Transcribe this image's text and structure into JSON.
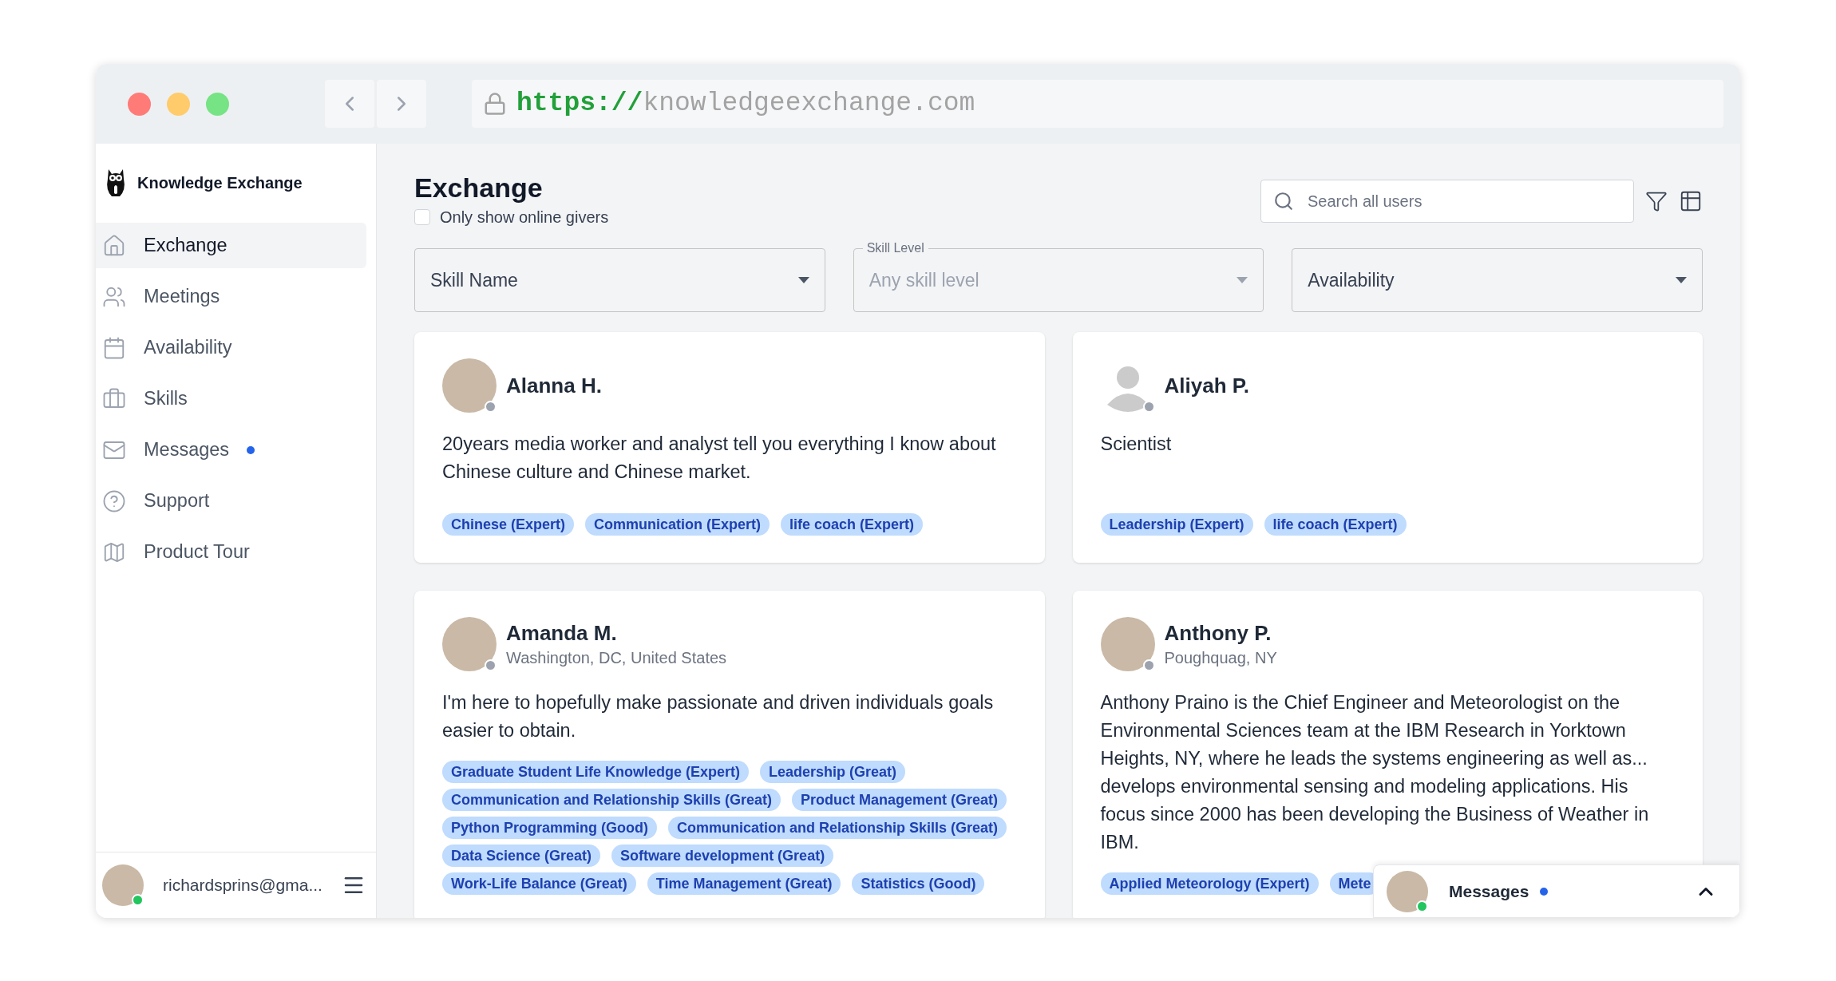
{
  "browser": {
    "url_scheme": "https://",
    "url_host": "knowledgeexchange.com"
  },
  "sidebar": {
    "brand": "Knowledge Exchange",
    "items": [
      {
        "label": "Exchange",
        "selected": true,
        "unread": false
      },
      {
        "label": "Meetings",
        "selected": false,
        "unread": false
      },
      {
        "label": "Availability",
        "selected": false,
        "unread": false
      },
      {
        "label": "Skills",
        "selected": false,
        "unread": false
      },
      {
        "label": "Messages",
        "selected": false,
        "unread": true
      },
      {
        "label": "Support",
        "selected": false,
        "unread": false
      },
      {
        "label": "Product Tour",
        "selected": false,
        "unread": false
      }
    ],
    "user": {
      "email": "richardsprins@gma...",
      "online": true
    }
  },
  "page": {
    "title": "Exchange",
    "online_filter": {
      "label": "Only show online givers",
      "checked": false
    },
    "search": {
      "placeholder": "Search all users"
    },
    "filters": [
      {
        "label": "Skill Name"
      },
      {
        "label": "Skill Level",
        "value": "Any skill level"
      },
      {
        "label": "Availability"
      }
    ]
  },
  "cards": [
    {
      "name": "Alanna H.",
      "avatar": {
        "kind": "photo"
      },
      "online": false,
      "bio": "20years media worker and analyst tell you everything I know about Chinese culture and Chinese market.",
      "tags": [
        "Chinese (Expert)",
        "Communication (Expert)",
        "life coach (Expert)"
      ]
    },
    {
      "name": "Aliyah P.",
      "avatar": {
        "kind": "silhouette"
      },
      "online": false,
      "bio": "Scientist",
      "tags": [
        "Leadership (Expert)",
        "life coach (Expert)"
      ]
    },
    {
      "name": "Amanda M.",
      "avatar": {
        "kind": "photo"
      },
      "location": "Washington, DC, United States",
      "online": false,
      "bio": "I'm here to hopefully make passionate and driven individuals goals easier to obtain.",
      "tags": [
        "Graduate Student Life Knowledge (Expert)",
        "Leadership (Great)",
        "Communication and Relationship Skills (Great)",
        "Product Management (Great)",
        "Python Programming (Good)",
        "Communication and Relationship Skills (Great)",
        "Data Science (Great)",
        "Software development (Great)",
        "Work-Life Balance (Great)",
        "Time Management (Great)",
        "Statistics (Good)"
      ]
    },
    {
      "name": "Anthony P.",
      "avatar": {
        "kind": "photo"
      },
      "location": "Poughquag, NY",
      "online": false,
      "bio": "Anthony Praino is the Chief Engineer and Meteorologist on the Environmental Sciences team at the IBM Research in Yorktown Heights, NY, where he leads the systems engineering as well as... develops environmental sensing and modeling applications. His focus since 2000 has been developing the Business of Weather in IBM.",
      "tags": [
        "Applied Meteorology (Expert)",
        "Mete"
      ]
    }
  ],
  "messages_popup": {
    "title": "Messages",
    "unread": true,
    "online": true
  }
}
